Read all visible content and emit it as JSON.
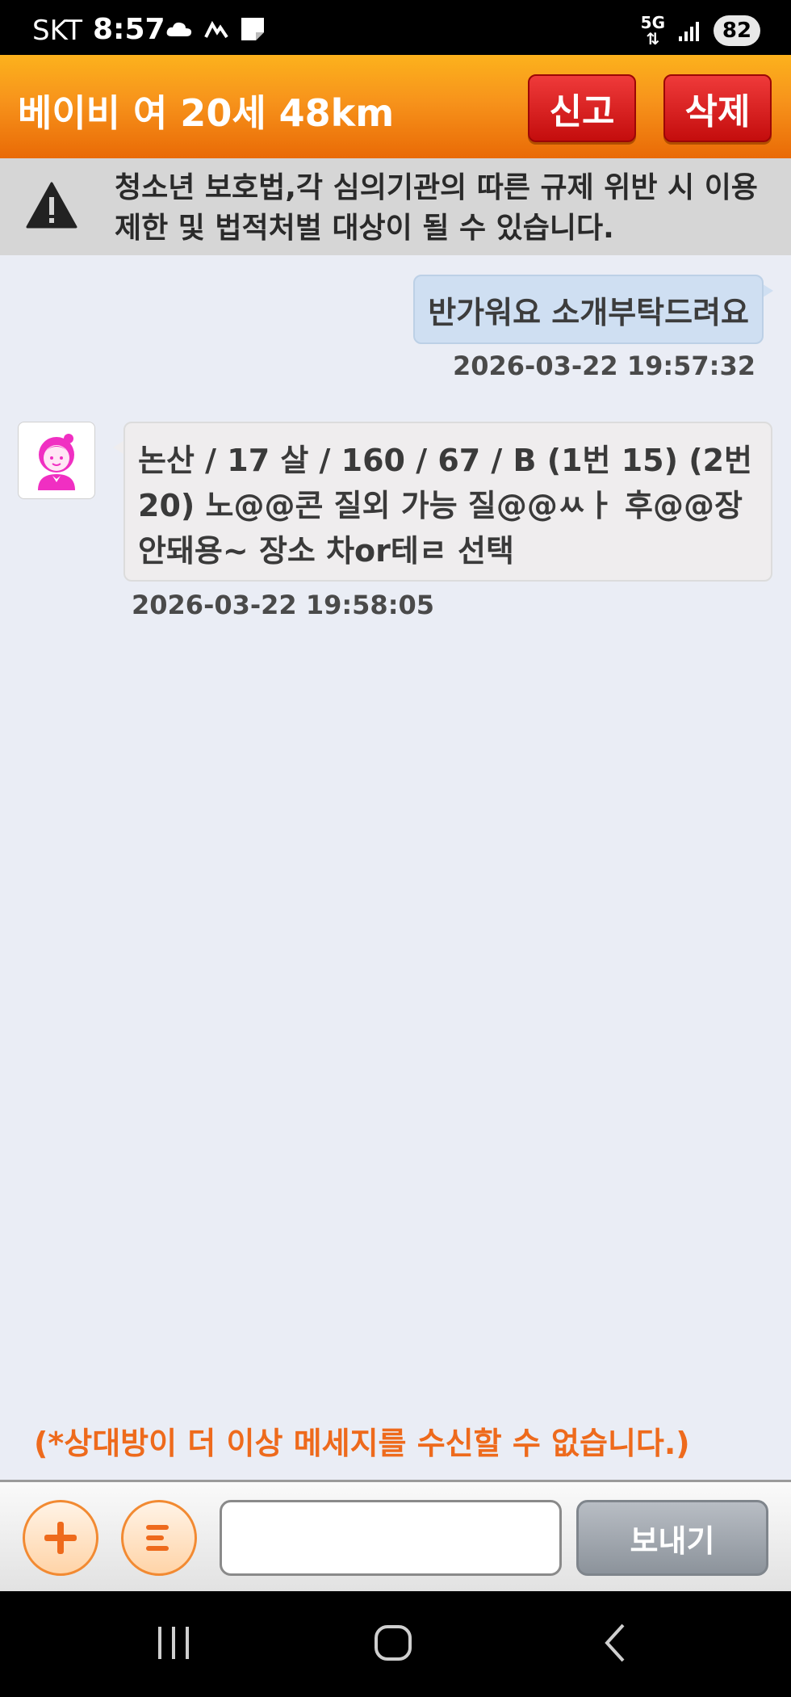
{
  "status_bar": {
    "carrier": "SKT",
    "time": "8:57",
    "network": "5G",
    "battery": "82"
  },
  "header": {
    "title": "베이비 여 20세 48km",
    "report_label": "신고",
    "delete_label": "삭제"
  },
  "warning": {
    "text": "청소년 보호법,각 심의기관의 따른 규제 위반 시 이용제한 및 법적처벌 대상이 될 수  있습니다."
  },
  "messages": [
    {
      "direction": "outgoing",
      "text": "반가워요 소개부탁드려요",
      "time": "2026-03-22 19:57:32"
    },
    {
      "direction": "incoming",
      "text": "논산 / 17 살 / 160 / 67 / B (1번 15) (2번 20) 노@@콘 질외 가능 질@@ㅆㅏ 후@@장 안돼용~ 장소 차or테ㄹ 선택",
      "time": "2026-03-22 19:58:05",
      "avatar_icon": "girl-avatar-icon"
    }
  ],
  "notice": "(*상대방이 더 이상 메세지를 수신할 수 없습니다.)",
  "input_bar": {
    "plus_icon": "plus-icon",
    "menu_icon": "menu-chat-icon",
    "message_value": "",
    "send_label": "보내기"
  },
  "colors": {
    "header_orange": "#f7931b",
    "button_red": "#d91c1c",
    "notice_orange": "#ee6a1c",
    "chat_bg": "#eaedf5",
    "outgoing_bubble": "#cfdff2",
    "incoming_bubble": "#efedee"
  }
}
